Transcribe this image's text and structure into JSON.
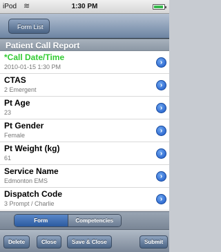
{
  "status_bar": {
    "carrier": "iPod",
    "time": "1:30 PM"
  },
  "nav": {
    "back_label": "Form List"
  },
  "section": {
    "title": "Patient Call Report"
  },
  "rows": [
    {
      "label": "*Call Date/Time",
      "value": "2010-01-15 1:30 PM",
      "required": true
    },
    {
      "label": "CTAS",
      "value": "2 Emergent",
      "required": false
    },
    {
      "label": "Pt Age",
      "value": "23",
      "required": false
    },
    {
      "label": "Pt Gender",
      "value": "Female",
      "required": false
    },
    {
      "label": "Pt Weight (kg)",
      "value": "61",
      "required": false
    },
    {
      "label": "Service Name",
      "value": "Edmonton EMS",
      "required": false
    },
    {
      "label": "Dispatch Code",
      "value": "3 Prompt / Charlie",
      "required": false
    }
  ],
  "segment": {
    "items": [
      "Form",
      "Competencies"
    ],
    "selected": "Form"
  },
  "toolbar": {
    "delete": "Delete",
    "close": "Close",
    "save_close": "Save & Close",
    "submit": "Submit"
  },
  "colors": {
    "required_label": "#33cc33",
    "disclosure": "#1b56c6",
    "nav": "#6d84a2"
  }
}
